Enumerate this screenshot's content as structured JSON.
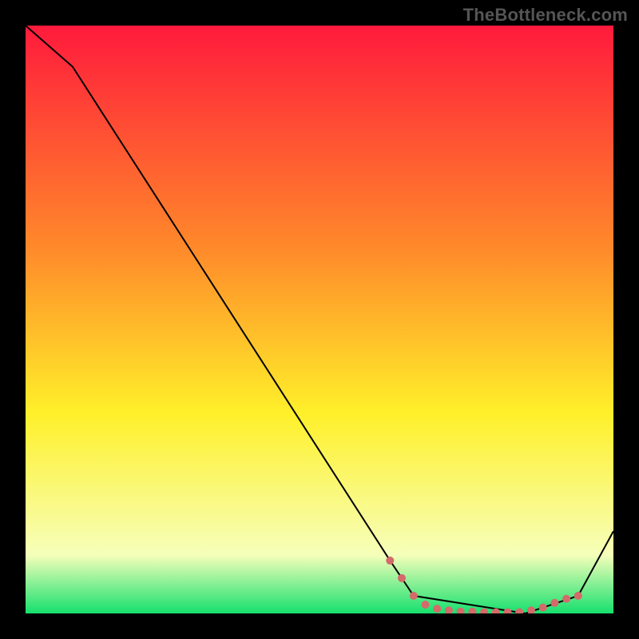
{
  "watermark": "TheBottleneck.com",
  "colors": {
    "background": "#000000",
    "line": "#000000",
    "marker": "#d46a6a",
    "gradient_red": "#ff1a3c",
    "gradient_orange": "#ff8a2a",
    "gradient_yellow": "#fff02a",
    "gradient_light": "#f6ffba",
    "gradient_green": "#16e06e"
  },
  "chart_data": {
    "type": "line",
    "title": "",
    "xlabel": "",
    "ylabel": "",
    "xlim": [
      0,
      100
    ],
    "ylim": [
      0,
      100
    ],
    "series": [
      {
        "name": "curve",
        "x": [
          0,
          8,
          62,
          66,
          85,
          94,
          100
        ],
        "y": [
          100,
          93,
          9,
          3,
          0,
          3,
          14
        ]
      }
    ],
    "markers": {
      "name": "highlight-points",
      "points": [
        {
          "x": 62,
          "y": 9
        },
        {
          "x": 64,
          "y": 6
        },
        {
          "x": 66,
          "y": 3
        },
        {
          "x": 68,
          "y": 1.5
        },
        {
          "x": 70,
          "y": 0.8
        },
        {
          "x": 72,
          "y": 0.5
        },
        {
          "x": 74,
          "y": 0.3
        },
        {
          "x": 76,
          "y": 0.3
        },
        {
          "x": 78,
          "y": 0.2
        },
        {
          "x": 80,
          "y": 0.2
        },
        {
          "x": 82,
          "y": 0.2
        },
        {
          "x": 84,
          "y": 0.2
        },
        {
          "x": 86,
          "y": 0.5
        },
        {
          "x": 88,
          "y": 1.0
        },
        {
          "x": 90,
          "y": 1.8
        },
        {
          "x": 92,
          "y": 2.5
        },
        {
          "x": 94,
          "y": 3
        }
      ]
    }
  }
}
